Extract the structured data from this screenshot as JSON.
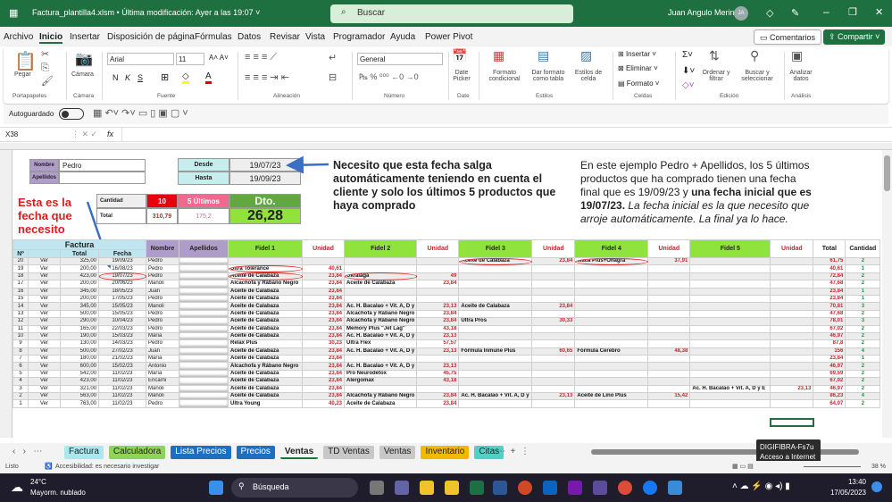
{
  "titlebar": {
    "doc_title": "Factura_plantilla4.xlsm • Última modificación: Ayer a las 19:07 ˅",
    "search_placeholder": "Buscar",
    "user": "Juan Angulo Merino",
    "avatar": "JA"
  },
  "menu": [
    "Archivo",
    "Inicio",
    "Insertar",
    "Disposición de página",
    "Fórmulas",
    "Datos",
    "Revisar",
    "Vista",
    "Programador",
    "Ayuda",
    "Power Pivot"
  ],
  "comments_button": "Comentarios",
  "share_button": "Compartir",
  "ribbon": {
    "paste": "Pegar",
    "camera": "Cámara",
    "font": "Arial",
    "size": "11",
    "bold": "N",
    "italic": "K",
    "underline": "S",
    "number_format": "General",
    "date_picker": "Date Picker",
    "cond_format": "Formato condicional",
    "table_format": "Dar formato como tabla",
    "cell_styles": "Estilos de celda",
    "insert": "Insertar",
    "delete": "Eliminar",
    "format": "Formato",
    "sort": "Ordenar y filtrar",
    "find": "Buscar y seleccionar",
    "analyze": "Analizar datos",
    "groups": [
      "Portapapeles",
      "Cámara",
      "Fuente",
      "Alineación",
      "Número",
      "Date",
      "Estilos",
      "Celdas",
      "Edición",
      "Análisis"
    ]
  },
  "qat": {
    "autosave": "Autoguardado"
  },
  "formula_bar": {
    "cell_ref": "X38",
    "fx": "fx",
    "value": ""
  },
  "form": {
    "nombre_label": "Nombre",
    "nombre_value": "Pedro",
    "apellidos_label": "Apellidos",
    "desde_label": "Desde",
    "desde_value": "19/07/23",
    "hasta_label": "Hasta",
    "hasta_value": "19/09/23",
    "cantidad_label": "Cantidad",
    "cantidad_value": "10",
    "ultimos_label": "5 Últimos",
    "total_label": "Total",
    "total_value": "310,79",
    "ultimos_total": "175,2",
    "dto_label": "Dto.",
    "dto_value": "26,28"
  },
  "notes": {
    "red_note": "Esta es la fecha que necesito",
    "blue_note": "Necesito que esta fecha salga automáticamente teniendo en cuenta el cliente y solo los últimos 5 productos que haya comprado",
    "right_1": "En este ejemplo Pedro + Apellidos, los 5 últimos productos que ha comprado tienen una fecha final que es 19/09/23 y ",
    "right_2": "una fecha inicial que es 19/07/23.",
    "right_3": " La fecha inicial es la que necesito que arroje automáticamente. La final ya lo hace."
  },
  "table": {
    "group_header": "Factura",
    "headers": [
      "Nº",
      "",
      "Total",
      "Fecha",
      "Nombre",
      "Apellidos",
      "Fidel 1",
      "Unidad",
      "Fidel 2",
      "Unidad",
      "Fidel 3",
      "Unidad",
      "Fidel 4",
      "Unidad",
      "Fidel 5",
      "Unidad",
      "Total",
      "Cantidad"
    ],
    "rows": [
      [
        "20",
        "Ver",
        "325,00",
        "19/09/23",
        "Pedro",
        "",
        "",
        "",
        "",
        "",
        "Aceite de Calabaza",
        "23,84",
        "Maca Plus+Onagra",
        "37,91",
        "",
        "",
        "61,75",
        "2"
      ],
      [
        "19",
        "Ver",
        "200,00",
        "16/08/23",
        "Pedro",
        "",
        "Ultra Tolerance",
        "40,61",
        "",
        "",
        "",
        "",
        "",
        "",
        "",
        "",
        "40,61",
        "1"
      ],
      [
        "18",
        "Ver",
        "423,00",
        "19/07/23",
        "Pedro",
        "",
        "Aceite de Calabaza",
        "23,84",
        "Ukralaga",
        "49",
        "",
        "",
        "",
        "",
        "",
        "",
        "72,84",
        "2"
      ],
      [
        "17",
        "Ver",
        "200,00",
        "20/06/23",
        "Manoli",
        "",
        "Alcachofa y Rábano Negro",
        "23,84",
        "Aceite de Calabaza",
        "23,84",
        "",
        "",
        "",
        "",
        "",
        "",
        "47,68",
        "2"
      ],
      [
        "16",
        "Ver",
        "345,00",
        "18/05/23",
        "Juan",
        "",
        "Aceite de Calabaza",
        "23,84",
        "",
        "",
        "",
        "",
        "",
        "",
        "",
        "",
        "23,84",
        "1"
      ],
      [
        "15",
        "Ver",
        "200,00",
        "17/05/23",
        "Pedro",
        "",
        "Aceite de Calabaza",
        "23,84",
        "",
        "",
        "",
        "",
        "",
        "",
        "",
        "",
        "23,84",
        "1"
      ],
      [
        "14",
        "Ver",
        "345,00",
        "15/05/23",
        "Manoli",
        "",
        "Aceite de Calabaza",
        "23,84",
        "Ac. H. Bacalao + Vit. A, D y",
        "23,13",
        "Aceite de Calabaza",
        "23,84",
        "",
        "",
        "",
        "",
        "70,81",
        "3"
      ],
      [
        "13",
        "Ver",
        "500,00",
        "15/05/23",
        "Pedro",
        "",
        "Aceite de Calabaza",
        "23,84",
        "Alcachofa y Rábano Negro",
        "23,84",
        "",
        "",
        "",
        "",
        "",
        "",
        "47,68",
        "2"
      ],
      [
        "12",
        "Ver",
        "290,00",
        "10/04/23",
        "Pedro",
        "",
        "Aceite de Calabaza",
        "23,84",
        "Alcachofa y Rábano Negro",
        "23,84",
        "Ultra Pros",
        "30,33",
        "",
        "",
        "",
        "",
        "78,01",
        "3"
      ],
      [
        "11",
        "Ver",
        "165,00",
        "22/03/23",
        "Pedro",
        "",
        "Aceite de Calabaza",
        "23,84",
        "Memory Plus \"Jet Lag\"",
        "43,18",
        "",
        "",
        "",
        "",
        "",
        "",
        "67,02",
        "2"
      ],
      [
        "10",
        "Ver",
        "190,00",
        "15/03/23",
        "María",
        "",
        "Aceite de Calabaza",
        "23,84",
        "Ac. H. Bacalao + Vit. A, D y",
        "23,13",
        "",
        "",
        "",
        "",
        "",
        "",
        "46,97",
        "2"
      ],
      [
        "9",
        "Ver",
        "130,00",
        "14/03/23",
        "Pedro",
        "",
        "Relax Plus",
        "30,23",
        "Ultra Flex",
        "57,57",
        "",
        "",
        "",
        "",
        "",
        "",
        "87,8",
        "2"
      ],
      [
        "8",
        "Ver",
        "500,00",
        "27/02/23",
        "Juan",
        "",
        "Aceite de Calabaza",
        "23,84",
        "Ac. H. Bacalao + Vit. A, D y",
        "23,13",
        "Fórmula Inmune Plus",
        "60,65",
        "Fórmula Cerebro",
        "48,38",
        "",
        "",
        "156",
        "4"
      ],
      [
        "7",
        "Ver",
        "180,00",
        "21/02/23",
        "María",
        "",
        "Aceite de Calabaza",
        "23,84",
        "",
        "",
        "",
        "",
        "",
        "",
        "",
        "",
        "23,84",
        "1"
      ],
      [
        "6",
        "Ver",
        "600,00",
        "15/02/23",
        "Antonio",
        "",
        "Alcachofa y Rábano Negro",
        "23,84",
        "Ac. H. Bacalao + Vit. A, D y",
        "23,13",
        "",
        "",
        "",
        "",
        "",
        "",
        "46,97",
        "2"
      ],
      [
        "5",
        "Ver",
        "542,00",
        "11/02/23",
        "María",
        "",
        "Aceite de Calabaza",
        "23,84",
        "Pro Neurodetox",
        "45,75",
        "",
        "",
        "",
        "",
        "",
        "",
        "69,59",
        "2"
      ],
      [
        "4",
        "Ver",
        "423,00",
        "11/02/23",
        "Encarni",
        "",
        "Aceite de Calabaza",
        "23,84",
        "Alergomax",
        "43,18",
        "",
        "",
        "",
        "",
        "",
        "",
        "67,02",
        "2"
      ],
      [
        "3",
        "Ver",
        "321,00",
        "11/02/23",
        "Manoli",
        "",
        "Aceite de Calabaza",
        "23,84",
        "",
        "",
        "",
        "",
        "",
        "",
        "Ac. H. Bacalao + Vit. A, D y E",
        "23,13",
        "46,97",
        "2"
      ],
      [
        "2",
        "Ver",
        "563,00",
        "11/02/23",
        "Manoli",
        "",
        "Aceite de Calabaza",
        "23,84",
        "Alcachofa y Rábano Negro",
        "23,84",
        "Ac. H. Bacalao + Vit. A, D y",
        "23,13",
        "Aceite de Lino Plus",
        "15,42",
        "",
        "",
        "86,23",
        "4"
      ],
      [
        "1",
        "Ver",
        "763,00",
        "11/02/23",
        "Pedro",
        "",
        "Ultra Young",
        "40,23",
        "Aceite de Calabaza",
        "23,84",
        "",
        "",
        "",
        "",
        "",
        "",
        "64,07",
        "2"
      ]
    ]
  },
  "sheet_tabs": [
    {
      "label": "Factura",
      "color": "#a8e8ee"
    },
    {
      "label": "Calculadora",
      "color": "#8fd45a"
    },
    {
      "label": "Lista Precios",
      "color": "#1e6fc0"
    },
    {
      "label": "Precios",
      "color": "#1e6fc0"
    },
    {
      "label": "Ventas",
      "color": ""
    },
    {
      "label": "TD Ventas",
      "color": "#c8c8c8"
    },
    {
      "label": "Ventas",
      "color": "#c8c8c8"
    },
    {
      "label": "Inventario",
      "color": "#f5b800"
    },
    {
      "label": "Citas",
      "color": "#4fd1c5"
    }
  ],
  "status": {
    "ready": "Listo",
    "accessibility": "Accesibilidad: es necesario investigar",
    "zoom": "38 %"
  },
  "tooltip": {
    "line1": "DIGIFIBRA-Fs7u",
    "line2": "Acceso a Internet"
  },
  "taskbar": {
    "temp": "24°C",
    "weather": "Mayorm. nublado",
    "search": "Búsqueda",
    "time": "13:40",
    "date": "17/05/2023"
  }
}
